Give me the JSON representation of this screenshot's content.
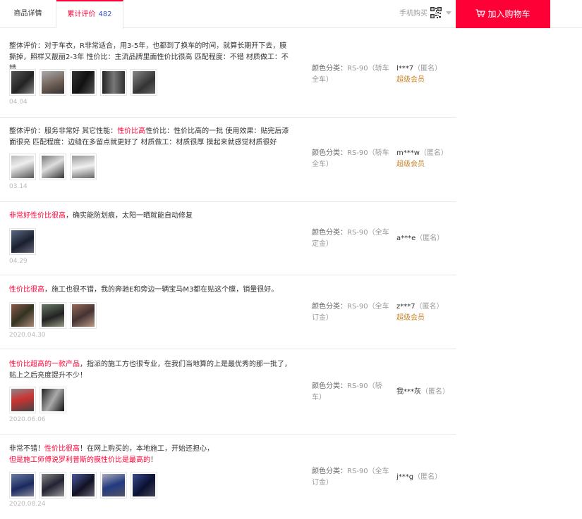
{
  "tabs": {
    "detail": "商品详情",
    "reviews_label": "累计评价",
    "reviews_count": "482"
  },
  "header": {
    "mobile_buy": "手机购买",
    "add_to_cart": "加入购物车"
  },
  "colors": {
    "accent": "#ff0036",
    "highlight": "#ff0036",
    "vip": "#c8862b",
    "count": "#3355cc"
  },
  "reviews": [
    {
      "text_plain": "整体评价：对于车衣，R非常适合，用3-5年，也都到了换车的时间，就算长期开下去，膜撕掉，照样又靓丽2-3年 性价比：主流品牌里面性价比很高 匹配程度：不错 材质做工：不错",
      "date": "04.04",
      "spec_label": "颜色分类：",
      "spec_value": "RS-90（轿车全车）",
      "user": "l***7",
      "anon": "（匿名）",
      "vip": "超级会员"
    },
    {
      "text_a": "整体评价：服务非常好 其它性能：",
      "text_hl": "性价比高",
      "text_b": "性价比：性价比高的一批 使用效果：贴完后漆面很亮 匹配程度：边缝在多留点就更好了 材质做工：材质很厚 摸起来就感觉材质很好",
      "date": "03.14",
      "spec_label": "颜色分类：",
      "spec_value": "RS-90（轿车全车）",
      "user": "m***w",
      "anon": "（匿名）",
      "vip": "超级会员"
    },
    {
      "text_hl": "非常好性价比很高",
      "text_b": "，确实能防划痕，太阳一晒就能自动修复",
      "date": "04.29",
      "spec_label": "颜色分类：",
      "spec_value": "RS-90（全车定金）",
      "user": "a***e",
      "anon": "（匿名）"
    },
    {
      "text_hl": "性价比很高",
      "text_b": "，施工也很不错，我的奔驰E和旁边一辆宝马M3都在贴这个膜，销量很好。",
      "date": "2020.04.30",
      "spec_label": "颜色分类：",
      "spec_value": "RS-90（全车订金）",
      "user": "z***7",
      "anon": "（匿名）",
      "vip": "超级会员"
    },
    {
      "text_hl": "性价比超高的一款产品",
      "text_b": "，指派的施工方也很专业，在我们当地算的上是最优秀的那一批了，贴上之后亮度提升不少！",
      "date": "2020.06.06",
      "spec_label": "颜色分类：",
      "spec_value": "RS-90（轿车）",
      "user": "我***灰",
      "anon": "（匿名）"
    },
    {
      "text_a": "非常不错！",
      "text_hl": "性价比很高",
      "text_b": "！在网上购买的，本地施工，开始还担心，",
      "text_line2": "但是施工师傅说罗利普斯的膜性价比是最高的",
      "text_line2_end": "！",
      "date": "2020.08.24",
      "spec_label": "颜色分类：",
      "spec_value": "RS-90（全车订金）",
      "user": "j***g",
      "anon": "（匿名）"
    }
  ]
}
